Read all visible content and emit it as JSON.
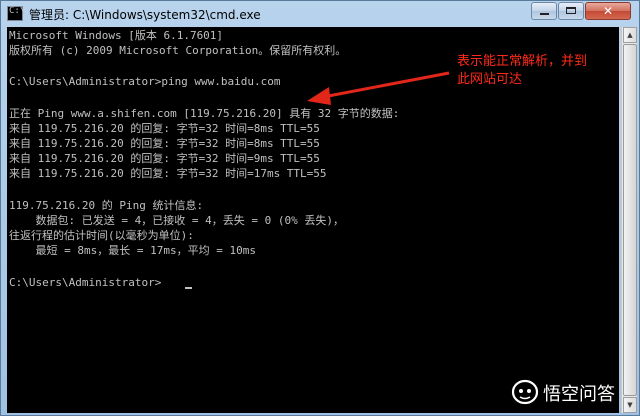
{
  "window": {
    "title": "管理员: C:\\Windows\\system32\\cmd.exe",
    "icon_label": "C:\\",
    "minimize_icon": "minimize-icon",
    "maximize_icon": "maximize-icon",
    "close_icon": "close-icon",
    "close_glyph": "✕"
  },
  "console": {
    "lines": [
      "Microsoft Windows [版本 6.1.7601]",
      "版权所有 (c) 2009 Microsoft Corporation。保留所有权利。",
      "",
      "C:\\Users\\Administrator>ping www.baidu.com",
      "",
      "正在 Ping www.a.shifen.com [119.75.216.20] 具有 32 字节的数据:",
      "来自 119.75.216.20 的回复: 字节=32 时间=8ms TTL=55",
      "来自 119.75.216.20 的回复: 字节=32 时间=8ms TTL=55",
      "来自 119.75.216.20 的回复: 字节=32 时间=9ms TTL=55",
      "来自 119.75.216.20 的回复: 字节=32 时间=17ms TTL=55",
      "",
      "119.75.216.20 的 Ping 统计信息:",
      "    数据包: 已发送 = 4，已接收 = 4，丢失 = 0 (0% 丢失)，",
      "往返行程的估计时间(以毫秒为单位):",
      "    最短 = 8ms，最长 = 17ms，平均 = 10ms",
      "",
      "C:\\Users\\Administrator>"
    ],
    "text_color": "#c0c0c0",
    "background": "#000000"
  },
  "annotation": {
    "line1": "表示能正常解析，并到",
    "line2": "此网站可达",
    "color": "#ff2a1a"
  },
  "scrollbar": {
    "up_arrow": "▲",
    "down_arrow": "▼"
  },
  "watermark": {
    "logo_icon": "wukong-logo-icon",
    "text": "悟空问答"
  }
}
